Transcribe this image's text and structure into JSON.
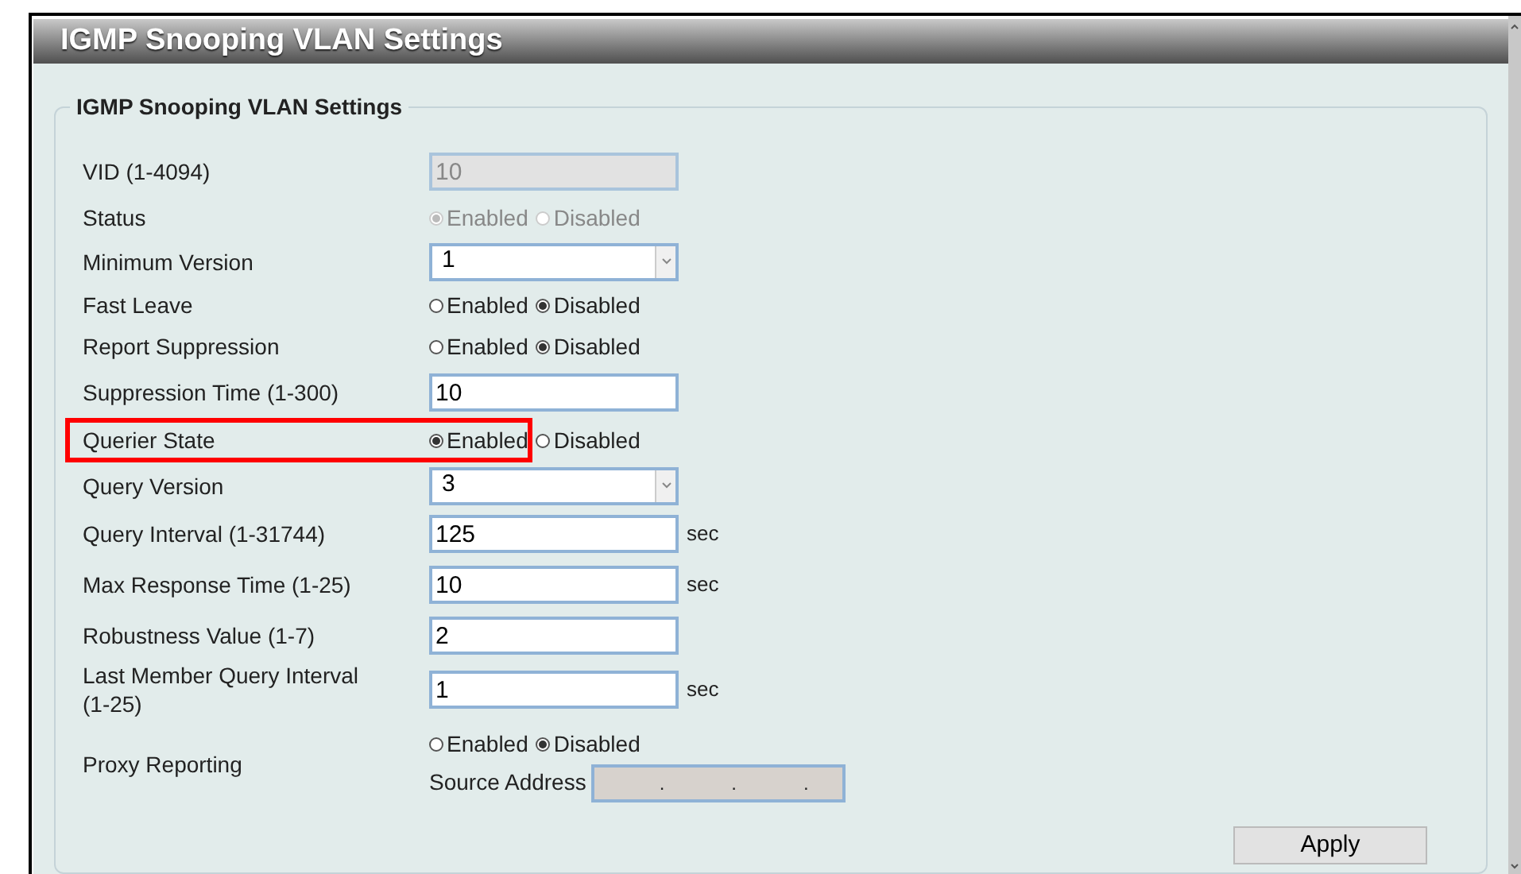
{
  "window": {
    "title": "IGMP Snooping VLAN Settings"
  },
  "fieldset": {
    "legend": "IGMP Snooping VLAN Settings",
    "rows": [
      {
        "kind": "input",
        "label": "VID (1-4094)",
        "value": "10",
        "disabled": true
      },
      {
        "kind": "radio",
        "label": "Status",
        "disabled": true,
        "options": [
          {
            "label": "Enabled",
            "selected": true
          },
          {
            "label": "Disabled",
            "selected": false
          }
        ]
      },
      {
        "kind": "select",
        "label": "Minimum Version",
        "value": "1"
      },
      {
        "kind": "radio",
        "label": "Fast Leave",
        "options": [
          {
            "label": "Enabled",
            "selected": false
          },
          {
            "label": "Disabled",
            "selected": true
          }
        ]
      },
      {
        "kind": "radio",
        "label": "Report Suppression",
        "options": [
          {
            "label": "Enabled",
            "selected": false
          },
          {
            "label": "Disabled",
            "selected": true
          }
        ]
      },
      {
        "kind": "input",
        "label": "Suppression Time (1-300)",
        "value": "10"
      },
      {
        "kind": "radio",
        "label": "Querier State",
        "highlighted": true,
        "options": [
          {
            "label": "Enabled",
            "selected": true
          },
          {
            "label": "Disabled",
            "selected": false
          }
        ]
      },
      {
        "kind": "select",
        "label": "Query Version",
        "value": "3"
      },
      {
        "kind": "input",
        "label": "Query Interval (1-31744)",
        "value": "125",
        "unit": "sec"
      },
      {
        "kind": "input",
        "label": "Max Response Time (1-25)",
        "value": "10",
        "unit": "sec"
      },
      {
        "kind": "input",
        "label": "Robustness Value (1-7)",
        "value": "2"
      },
      {
        "kind": "input",
        "label": "Last Member Query Interval (1-25)",
        "value": "1",
        "unit": "sec"
      },
      {
        "kind": "proxy",
        "label": "Proxy Reporting",
        "options": [
          {
            "label": "Enabled",
            "selected": false
          },
          {
            "label": "Disabled",
            "selected": true
          }
        ],
        "source": {
          "label": "Source Address",
          "parts": [
            ".",
            ".",
            "."
          ]
        }
      }
    ]
  },
  "apply_button": "Apply"
}
